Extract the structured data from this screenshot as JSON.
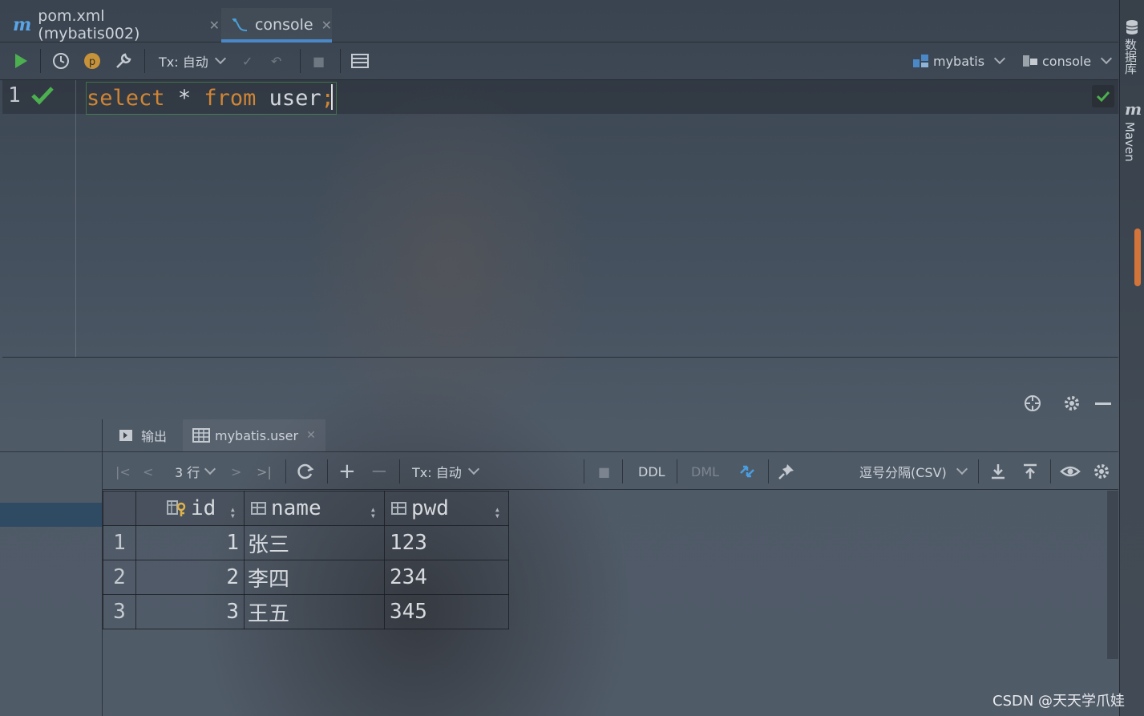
{
  "editor_tabs": [
    {
      "label": "pom.xml (mybatis002)",
      "icon": "maven-m-icon",
      "active": false
    },
    {
      "label": "console",
      "icon": "console-icon",
      "active": true
    }
  ],
  "toolbar": {
    "tx_label": "Tx: 自动",
    "datasource": "mybatis",
    "session": "console"
  },
  "editor": {
    "line_number": "1",
    "code": {
      "kw_select": "select",
      "star": "*",
      "kw_from": "from",
      "table": "user",
      "semicolon": ";"
    }
  },
  "right_sidebar": {
    "database_label": "数据库",
    "maven_label": "Maven"
  },
  "results": {
    "tabs": [
      {
        "label": "输出",
        "icon": "output-icon"
      },
      {
        "label": "mybatis.user",
        "icon": "table-icon",
        "closable": true
      }
    ],
    "row_count": "3 行",
    "tx_label": "Tx: 自动",
    "ddl_label": "DDL",
    "dml_label": "DML",
    "export_format": "逗号分隔(CSV)",
    "columns": [
      "id",
      "name",
      "pwd"
    ],
    "rows": [
      {
        "n": "1",
        "id": "1",
        "name": "张三",
        "pwd": "123"
      },
      {
        "n": "2",
        "id": "2",
        "name": "李四",
        "pwd": "234"
      },
      {
        "n": "3",
        "id": "3",
        "name": "王五",
        "pwd": "345"
      }
    ]
  },
  "watermark": "CSDN @天天学爪娃",
  "colors": {
    "accent": "#4a88c7",
    "keyword": "#d08535",
    "run_green": "#4caf50",
    "scroll_orange": "#d3743a"
  }
}
